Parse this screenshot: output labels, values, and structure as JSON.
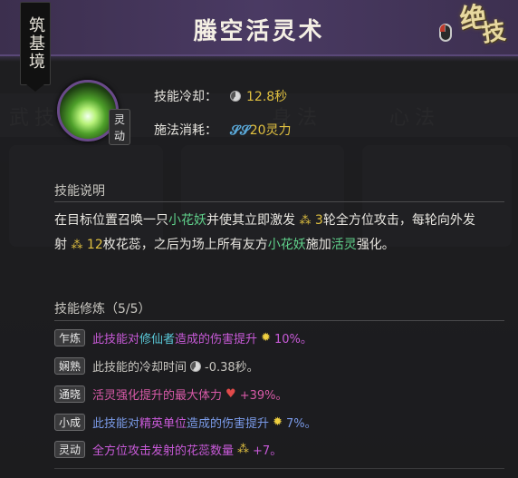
{
  "header": {
    "title": "螣空活灵术",
    "realm": "筑基境",
    "ult_line1": "绝",
    "ult_line2": "技"
  },
  "skill": {
    "tag": "灵动",
    "cooldown_label": "技能冷却：",
    "cooldown_value": "12.8秒",
    "cost_label": "施法消耗：",
    "cost_value": "20灵力"
  },
  "description": {
    "section_title": "技能说明",
    "seg1": "在目标位置召唤一只",
    "seg2": "小花妖",
    "seg3": "并使其立即激发",
    "seg4": "3",
    "seg5": "轮全方位攻击，每轮向外发射",
    "seg6": "12",
    "seg7": "枚花蕊，之后为场上所有友方",
    "seg8": "小花妖",
    "seg9": "施加",
    "seg10": "活灵",
    "seg11": "强化。"
  },
  "training": {
    "section_title": "技能修炼（5/5）",
    "rows": [
      {
        "badge": "乍炼",
        "a": "此技能对",
        "b": "修仙者",
        "c": "造成的伤害提升",
        "value": "10%。"
      },
      {
        "badge": "娴熟",
        "a": "此技能的冷却时间",
        "value": "-0.38秒。"
      },
      {
        "badge": "通晓",
        "a": "活灵",
        "c": "强化提升的最大体力",
        "value": "+39%。"
      },
      {
        "badge": "小成",
        "a": "此技能对",
        "b": "精英单位",
        "c": "造成的伤害提升",
        "value": "7%。"
      },
      {
        "badge": "灵动",
        "a": "全方位攻击发射的花蕊数量",
        "value": "+7。"
      }
    ]
  },
  "background": {
    "tab_wu": "武技",
    "tab_shen": "身法",
    "tab_xin": "心法"
  },
  "colors": {
    "accent_gold": "#e0c040",
    "highlight_green": "#5fd08a",
    "header_purple": "#4a3a63"
  }
}
